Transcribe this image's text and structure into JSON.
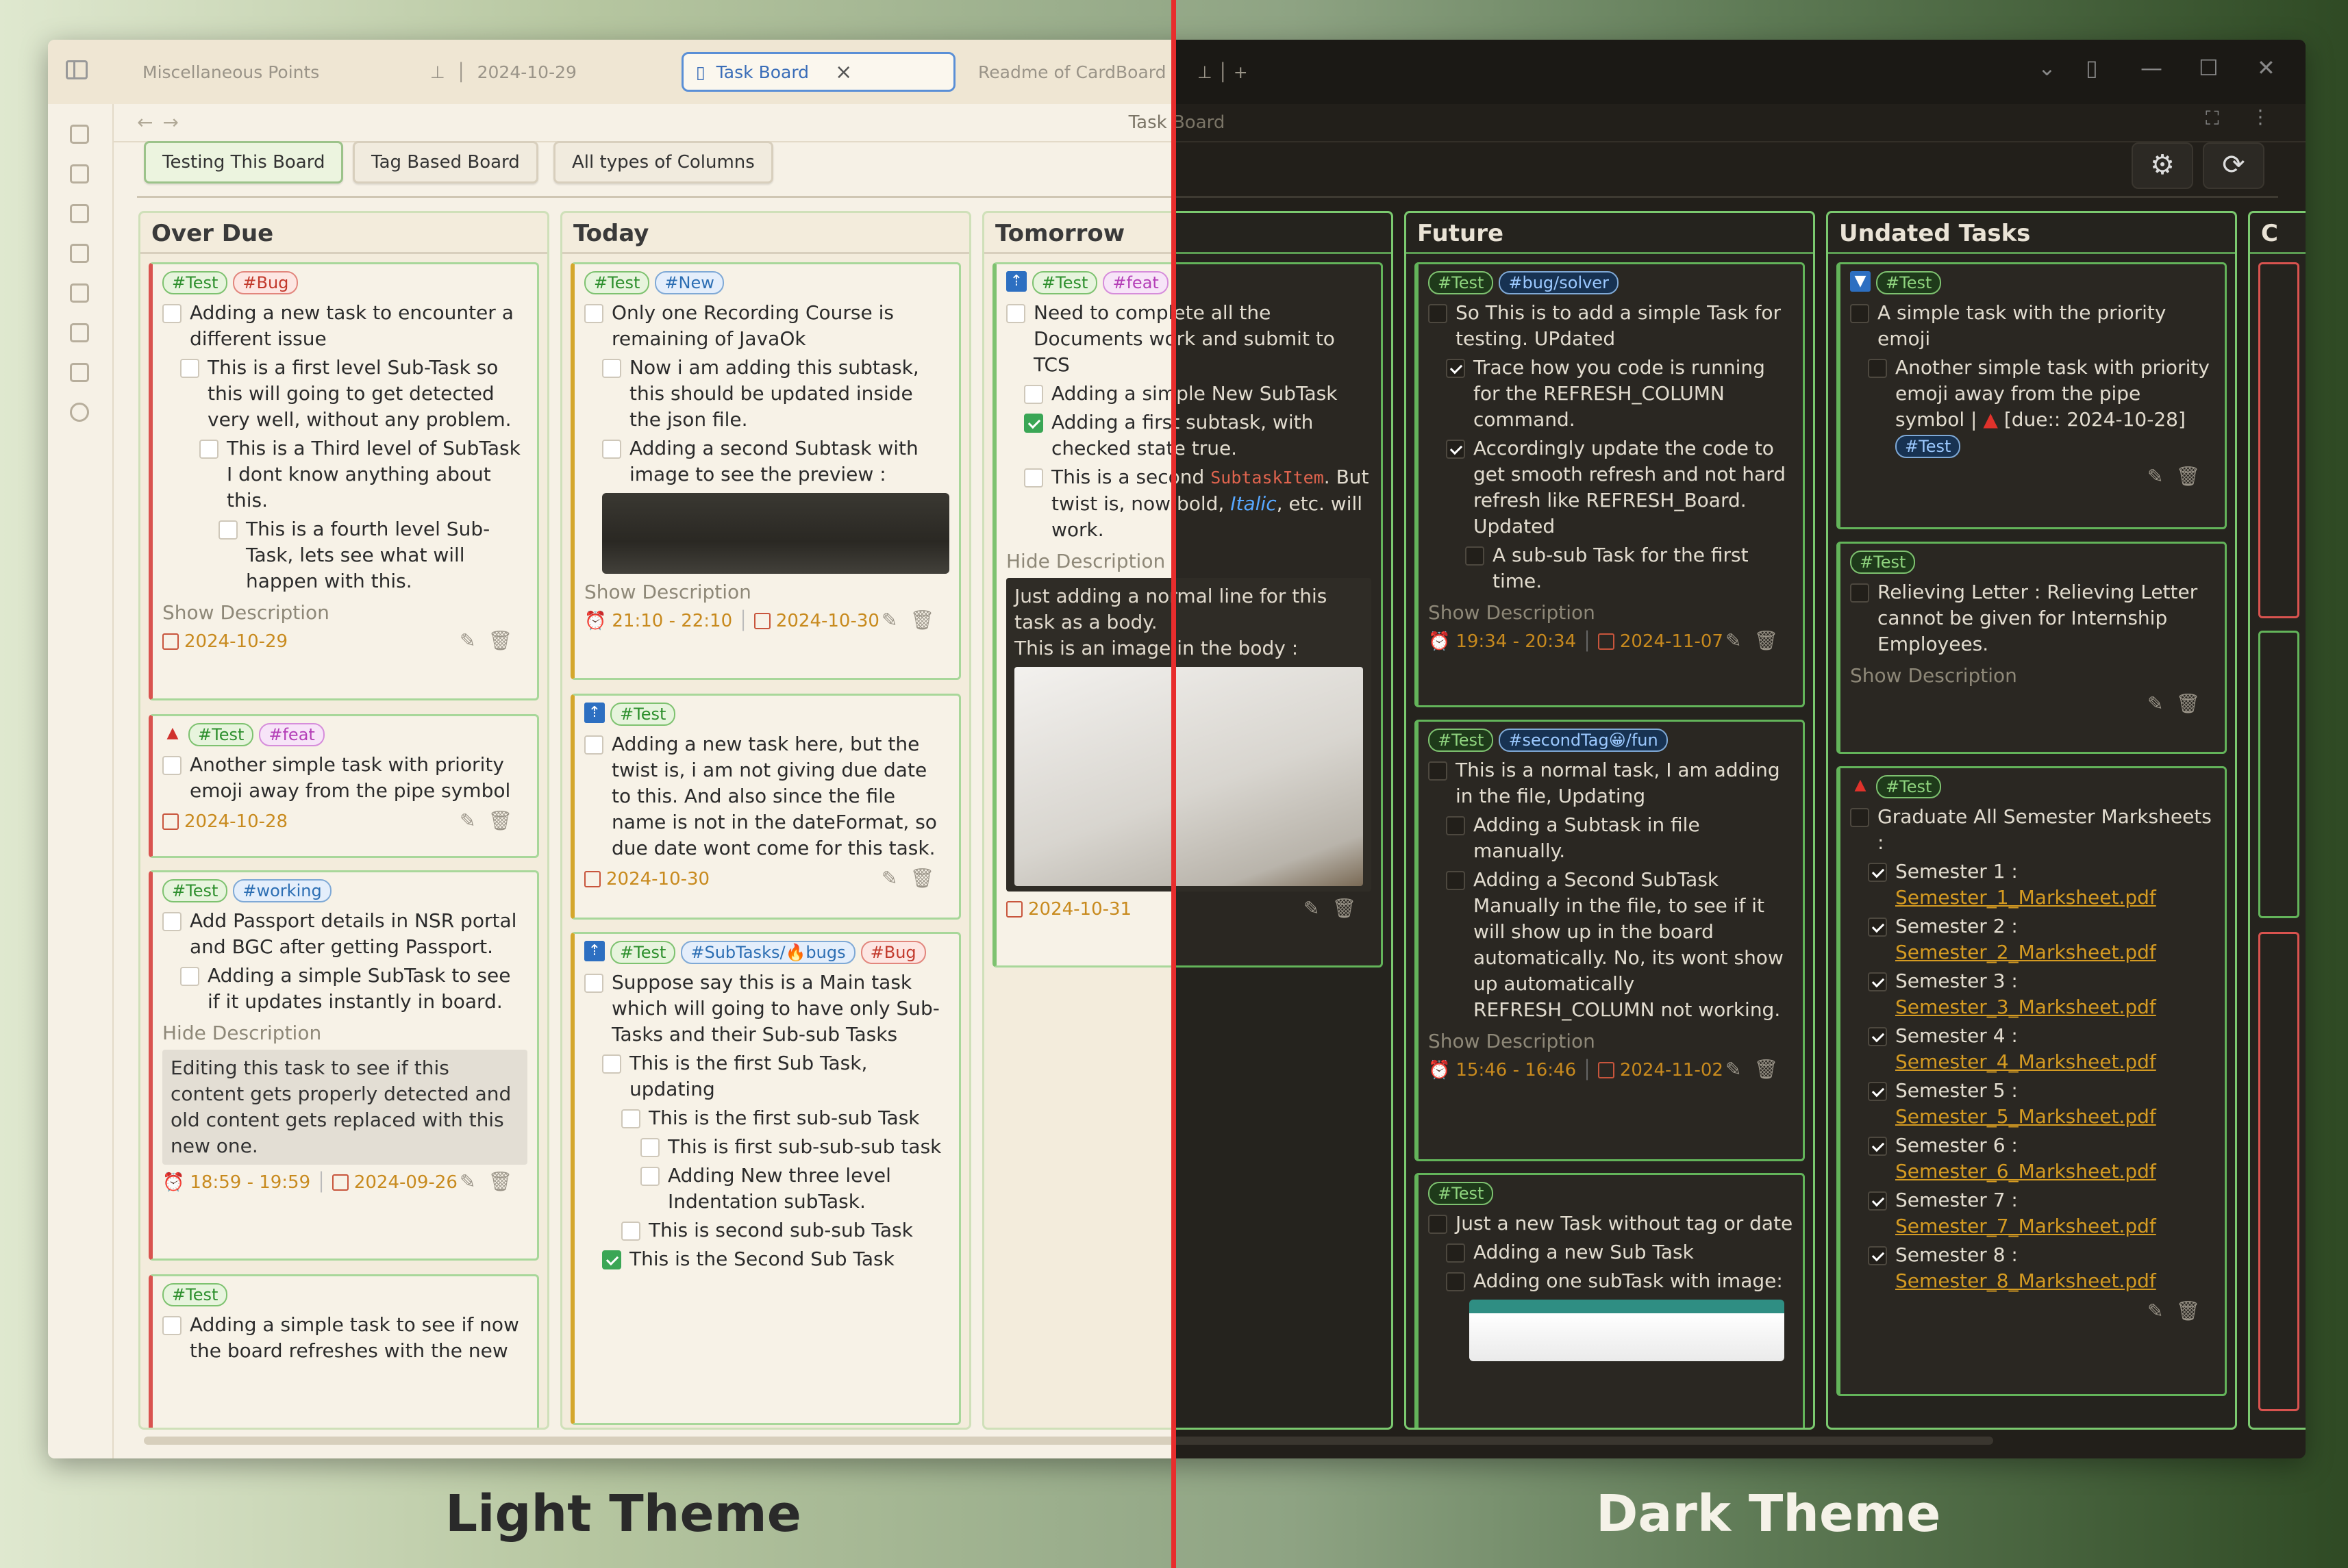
{
  "tabs": {
    "t1": "Miscellaneous Points",
    "t2": "2024-10-29",
    "t3": "Task Board",
    "t4": "Readme of CardBoard",
    "close": "×",
    "newtab": "+"
  },
  "window": {
    "title": "Task Board"
  },
  "board_tabs": [
    "Testing This Board",
    "Tag Based Board",
    "All types of Columns"
  ],
  "icons": {
    "settings": "⚙",
    "refresh": "⟳"
  },
  "columns": {
    "overdue": "Over Due",
    "today": "Today",
    "tomorrow": "Tomorrow",
    "future": "Future",
    "undated": "Undated Tasks",
    "c": "C"
  },
  "labels": {
    "show": "Show Description",
    "hide": "Hide Description"
  },
  "tags": {
    "test": "#Test",
    "bug": "#Bug",
    "new": "#New",
    "feat": "#feat",
    "working": "#working",
    "subtasks": "#SubTasks/🔥bugs",
    "bugsolver": "#bug/solver",
    "secondtag": "#secondTag😀/fun"
  },
  "overdue": {
    "c1": {
      "t1": "Adding a new task to encounter a different issue",
      "t2": "This is a first level Sub-Task so this will going to get detected very well, without any problem.",
      "t3": "This is a Third level of SubTask I dont know anything about this.",
      "t4": "This is a fourth level Sub-Task, lets see what will happen with this.",
      "date": "2024-10-29"
    },
    "c2": {
      "t1": "Another simple task with priority emoji away from the pipe symbol",
      "date": "2024-10-28"
    },
    "c3": {
      "t1": "Add Passport details in NSR portal and BGC after getting Passport.",
      "t2": "Adding a simple SubTask to see if it updates instantly in board.",
      "desc": "Editing this task to see if this content gets properly detected and old content gets replaced with this new one.",
      "time": "18:59 - 19:59",
      "date": "2024-09-26"
    },
    "c4": {
      "t1": "Adding a simple task to see if now the board refreshes with the new"
    }
  },
  "today": {
    "c1": {
      "t1": "Only one Recording Course is remaining of JavaOk",
      "t2": "Now i am adding this subtask, this should be updated inside the json file.",
      "t3": "Adding a second Subtask with image to see the preview :",
      "time": "21:10 - 22:10",
      "date": "2024-10-30"
    },
    "c2": {
      "t1": "Adding a new task here, but the twist is, i am not giving due date to this. And also since the file name is not in the dateFormat, so due date wont come for this task.",
      "date": "2024-10-30"
    },
    "c3": {
      "t1": "Suppose say this is a Main task which will going to have only Sub-Tasks and their Sub-sub Tasks",
      "t2": "This is the first Sub Task, updating",
      "t3": "This is the first sub-sub Task",
      "t4": "This is first sub-sub-sub task",
      "t5": "Adding New three level Indentation subTask.",
      "t6": "This is second sub-sub Task",
      "t7": "This is the Second Sub Task"
    }
  },
  "tomorrow": {
    "c1": {
      "t1": "Need to complete all the Documents work and submit to TCS",
      "t2": "Adding a simple New SubTask",
      "t3": "Adding a first subtask, with checked state true.",
      "t4a": "This is a second",
      "t4code": "SubtaskItem",
      "t4b": ". But twist is, now bold,",
      "t4it": "Italic",
      "t4c": ", etc. will work.",
      "desc1": "Just adding a normal line for this task as a body.",
      "desc2": "This is an image in the body :",
      "date": "2024-10-31"
    }
  },
  "future": {
    "c1": {
      "t1": "So This is to add a simple Task for testing. UPdated",
      "t2": "Trace how you code is running for the REFRESH_COLUMN command.",
      "t3": "Accordingly update the code to get smooth refresh and not hard refresh like REFRESH_Board. Updated",
      "t4": "A sub-sub Task for the first time.",
      "time": "19:34 - 20:34",
      "date": "2024-11-07"
    },
    "c2": {
      "t1": "This is a normal task, I am adding in the file, Updating",
      "t2": "Adding a Subtask in file manually.",
      "t3": "Adding a Second SubTask Manually in the file, to see if it will show up in the board automatically. No, its wont show up automatically REFRESH_COLUMN not working.",
      "time": "15:46 - 16:46",
      "date": "2024-11-02"
    },
    "c3": {
      "t1": "Just a new Task without tag or date",
      "t2": "Adding a new Sub Task",
      "t3": "Adding one subTask with image:"
    }
  },
  "undated": {
    "c1": {
      "t1": "A simple task with the priority emoji",
      "t2a": "Another simple task with priority emoji away from the pipe symbol |",
      "t2b": "[due:: 2024-10-28]"
    },
    "c2": {
      "t1": "Relieving Letter : Relieving Letter cannot be given for Internship Employees."
    },
    "c3": {
      "t1": "Graduate All Semester Marksheets :",
      "sems": [
        "Semester 1 :",
        "Semester 2 :",
        "Semester 3 :",
        "Semester 4 :",
        "Semester 5 :",
        "Semester 6 :",
        "Semester 7 :",
        "Semester 8 :"
      ],
      "files": [
        "Semester_1_Marksheet.pdf",
        "Semester_2_Marksheet.pdf",
        "Semester_3_Marksheet.pdf",
        "Semester_4_Marksheet.pdf",
        "Semester_5_Marksheet.pdf",
        "Semester_6_Marksheet.pdf",
        "Semester_7_Marksheet.pdf",
        "Semester_8_Marksheet.pdf"
      ]
    }
  },
  "captions": {
    "light": "Light Theme",
    "dark": "Dark Theme"
  }
}
